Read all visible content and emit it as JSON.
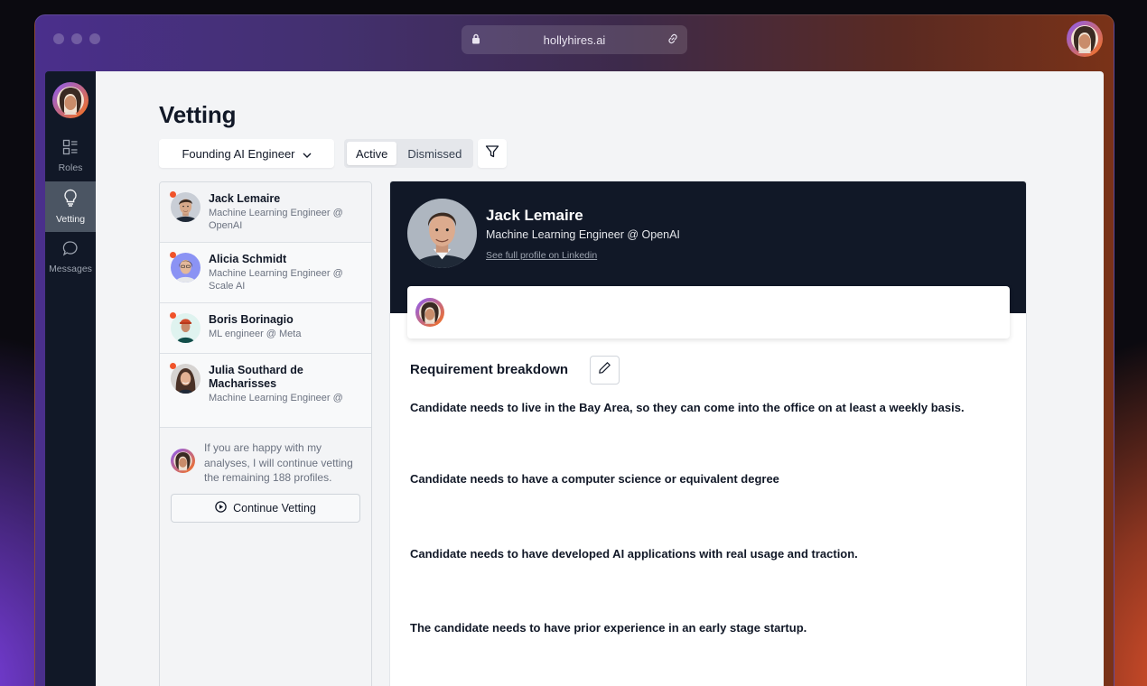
{
  "browser": {
    "url": "hollyhires.ai"
  },
  "sidebar": {
    "items": [
      {
        "label": "Roles",
        "icon": "roles-icon"
      },
      {
        "label": "Vetting",
        "icon": "lightbulb-icon"
      },
      {
        "label": "Messages",
        "icon": "message-icon"
      }
    ]
  },
  "page": {
    "title": "Vetting"
  },
  "toolbar": {
    "role_selected": "Founding AI Engineer",
    "tabs": [
      "Active",
      "Dismissed"
    ],
    "active_tab": "Active"
  },
  "candidates": [
    {
      "name": "Jack Lemaire",
      "role": "Machine Learning Engineer @ OpenAI",
      "unread": true
    },
    {
      "name": "Alicia Schmidt",
      "role": "Machine Learning Engineer @ Scale AI",
      "unread": true
    },
    {
      "name": "Boris Borinagio",
      "role": "ML engineer @ Meta",
      "unread": true
    },
    {
      "name": "Julia Southard de Macharisses",
      "role": "Machine Learning Engineer @",
      "unread": true
    }
  ],
  "assistant": {
    "message": "If you are happy with my analyses, I will continue vetting the remaining 188 profiles.",
    "continue_label": "Continue Vetting"
  },
  "detail": {
    "name": "Jack Lemaire",
    "role": "Machine Learning Engineer @ OpenAI",
    "profile_link": "See full profile on Linkedin",
    "section_title": "Requirement breakdown",
    "requirements": [
      "Candidate needs to live in the Bay Area, so they can come into the office on at least a weekly basis.",
      "Candidate needs to have a computer science or equivalent degree",
      "Candidate needs to have developed AI applications with real usage and traction.",
      "The candidate needs to have prior experience in an early stage startup."
    ]
  },
  "colors": {
    "sidebar_bg": "#111827",
    "accent_unread": "#f0532a",
    "header_bg": "#111827"
  }
}
